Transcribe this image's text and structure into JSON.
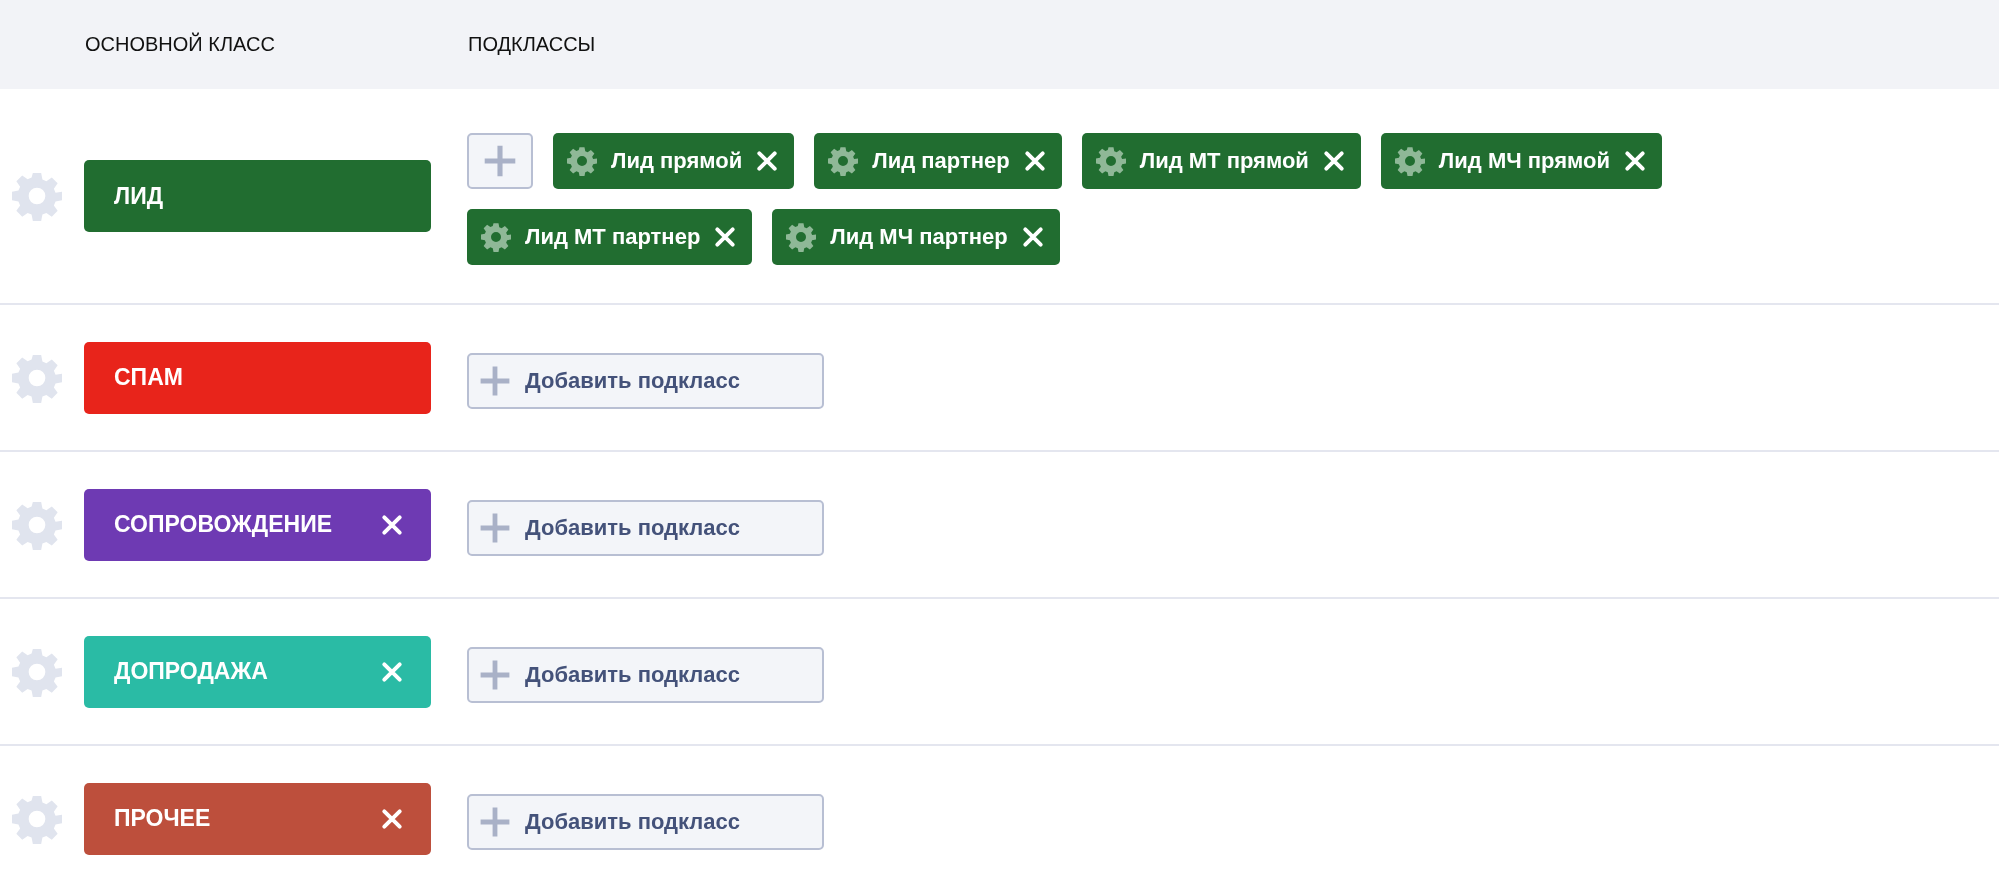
{
  "table": {
    "columns": [
      "ОСНОВНОЙ КЛАСС",
      "ПОДКЛАССЫ"
    ],
    "rows": [
      {
        "class": {
          "label": "ЛИД",
          "color": "#216d30",
          "removable": false
        },
        "subclasses": [
          {
            "label": "Лид прямой"
          },
          {
            "label": "Лид партнер"
          },
          {
            "label": "Лид МТ прямой"
          },
          {
            "label": "Лид МЧ прямой"
          },
          {
            "label": "Лид МТ партнер"
          },
          {
            "label": "Лид МЧ партнер"
          }
        ],
        "add_button": {}
      },
      {
        "class": {
          "label": "СПАМ",
          "color": "#e8241b",
          "removable": false
        },
        "add_button": {
          "label": "Добавить подкласс"
        }
      },
      {
        "class": {
          "label": "СОПРОВОЖДЕНИЕ",
          "color": "#6e3ab3",
          "removable": true
        },
        "add_button": {
          "label": "Добавить подкласс"
        }
      },
      {
        "class": {
          "label": "ДОПРОДАЖА",
          "color": "#2abba5",
          "removable": true
        },
        "add_button": {
          "label": "Добавить подкласс"
        }
      },
      {
        "class": {
          "label": "ПРОЧЕЕ",
          "color": "#bd4f3c",
          "removable": true
        },
        "add_button": {
          "label": "Добавить подкласс"
        }
      }
    ]
  }
}
